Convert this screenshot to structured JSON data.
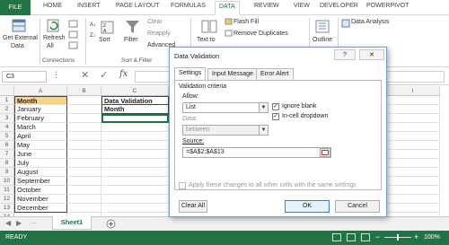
{
  "ribbon": {
    "tabs": [
      "FILE",
      "HOME",
      "INSERT",
      "PAGE LAYOUT",
      "FORMULAS",
      "DATA",
      "REVIEW",
      "VIEW",
      "DEVELOPER",
      "POWERPIVOT"
    ],
    "get_external_data": "Get External",
    "get_external_data2": "Data",
    "refresh": "Refresh",
    "refresh2": "All",
    "sort": "Sort",
    "filter": "Filter",
    "clear": "Clear",
    "reapply": "Reapply",
    "advanced": "Advanced",
    "text_to": "Text to",
    "flash_fill": "Flash Fill",
    "remove_duplicates": "Remove Duplicates",
    "outline": "Outline",
    "data_analysis": "Data Analysis",
    "group_connections": "Connections",
    "group_sort_filter": "Sort & Filter"
  },
  "formula_bar": {
    "name_box": "C3",
    "fx": "fx"
  },
  "columns": [
    "A",
    "B",
    "C",
    "I"
  ],
  "rows": [
    "1",
    "2",
    "3",
    "4",
    "5",
    "6",
    "7",
    "8",
    "9",
    "10",
    "11",
    "12",
    "13",
    "14"
  ],
  "cells": {
    "a": [
      "Month",
      "January",
      "February",
      "March",
      "April",
      "May",
      "June",
      "July",
      "August",
      "September",
      "October",
      "November",
      "December"
    ],
    "c1": "Data Validation",
    "c2": "Month"
  },
  "sheet_tab": "Sheet1",
  "status": {
    "ready": "READY",
    "zoom": "100%"
  },
  "dialog": {
    "title": "Data Validation",
    "help": "?",
    "close": "✕",
    "tabs": [
      "Settings",
      "Input Message",
      "Error Alert"
    ],
    "criteria_label": "Validation criteria",
    "allow_label": "Allow:",
    "allow_value": "List",
    "ignore_blank": "Ignore blank",
    "incell_dropdown": "In-cell dropdown",
    "data_label": "Data:",
    "data_value": "between",
    "source_label": "Source:",
    "source_value": "=$A$2:$A$13",
    "apply_all": "Apply these changes to all other cells with the same settings",
    "clear_all": "Clear All",
    "ok": "OK",
    "cancel": "Cancel"
  }
}
